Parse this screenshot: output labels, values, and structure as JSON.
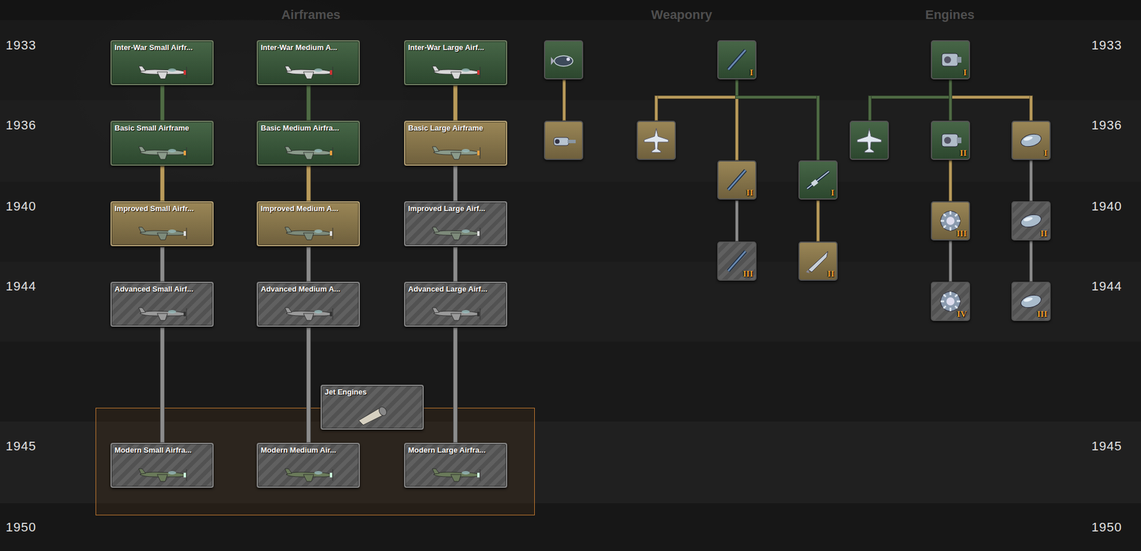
{
  "headers": [
    {
      "label": "Airframes"
    },
    {
      "label": "Weaponry"
    },
    {
      "label": "Engines"
    }
  ],
  "years": [
    "1933",
    "1936",
    "1940",
    "1944",
    "1945",
    "1950"
  ],
  "airframes": [
    [
      {
        "label": "Inter-War Small Airfr...",
        "state": "researched"
      },
      {
        "label": "Basic Small Airframe",
        "state": "researched"
      },
      {
        "label": "Improved Small Airfr...",
        "state": "available"
      },
      {
        "label": "Advanced Small Airf...",
        "state": "locked"
      },
      {
        "label": "Modern Small Airfra...",
        "state": "locked"
      }
    ],
    [
      {
        "label": "Inter-War Medium A...",
        "state": "researched"
      },
      {
        "label": "Basic Medium Airfra...",
        "state": "researched"
      },
      {
        "label": "Improved Medium A...",
        "state": "available"
      },
      {
        "label": "Advanced Medium A...",
        "state": "locked"
      },
      {
        "label": "Modern Medium Air...",
        "state": "locked"
      }
    ],
    [
      {
        "label": "Inter-War Large Airf...",
        "state": "researched"
      },
      {
        "label": "Basic Large Airframe",
        "state": "available"
      },
      {
        "label": "Improved Large Airf...",
        "state": "locked"
      },
      {
        "label": "Advanced Large Airf...",
        "state": "locked"
      },
      {
        "label": "Modern Large Airfra...",
        "state": "locked"
      }
    ]
  ],
  "jet_engines": {
    "label": "Jet Engines",
    "state": "locked"
  },
  "modern_group": {
    "highlighted": true
  },
  "weaponry": [
    {
      "state": "researched",
      "parent": null
    },
    {
      "state": "available",
      "parent": 0
    },
    {
      "numeral": "I",
      "state": "researched",
      "parent": null
    },
    {
      "state": "available",
      "parent": 2
    },
    {
      "numeral": "II",
      "state": "available",
      "parent": 2
    },
    {
      "numeral": "I",
      "state": "researched",
      "parent": 2
    },
    {
      "numeral": "III",
      "state": "locked",
      "parent": 4
    },
    {
      "numeral": "II",
      "state": "available",
      "parent": 5
    }
  ],
  "engines": [
    {
      "numeral": "I",
      "state": "researched",
      "parent": null
    },
    {
      "state": "researched",
      "parent": 0
    },
    {
      "numeral": "II",
      "state": "researched",
      "parent": 0
    },
    {
      "numeral": "I",
      "state": "available",
      "parent": 0
    },
    {
      "numeral": "III",
      "state": "available",
      "parent": 2
    },
    {
      "numeral": "II",
      "state": "locked",
      "parent": 3
    },
    {
      "numeral": "IV",
      "state": "locked",
      "parent": 4
    },
    {
      "numeral": "III",
      "state": "locked",
      "parent": 5
    }
  ]
}
